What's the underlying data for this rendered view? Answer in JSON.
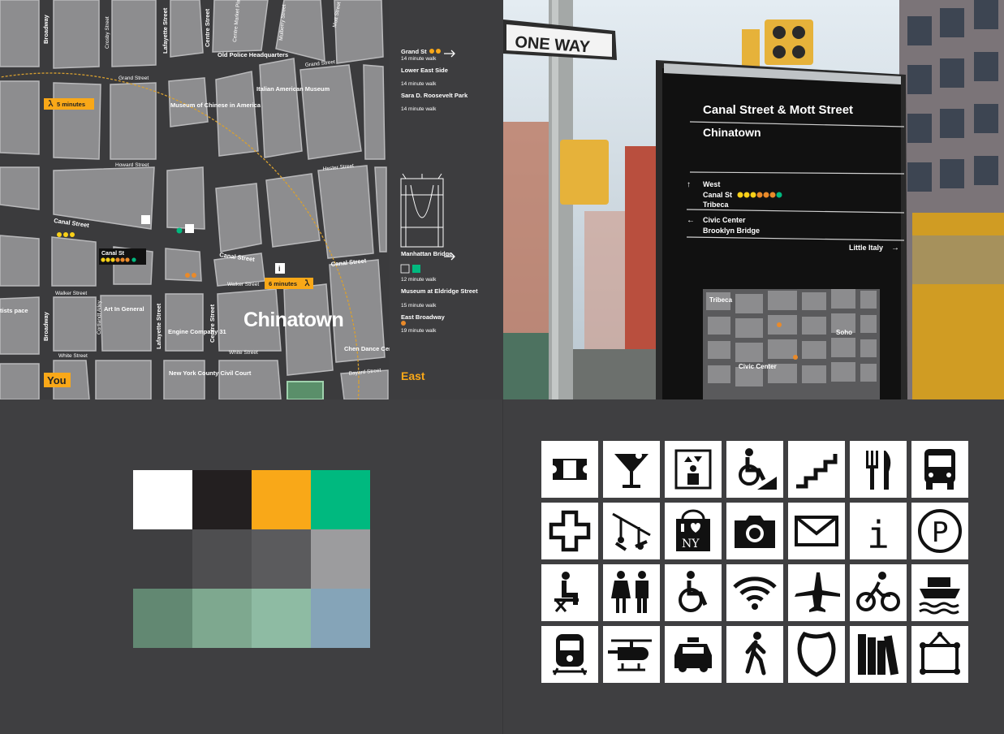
{
  "map": {
    "streets": {
      "broadway_top": "Broadway",
      "crosby": "Crosby Street",
      "lafayette_top": "Lafayette Street",
      "centre_top": "Centre Street",
      "centre_market": "Centre Market Place",
      "mulberry": "Mulberry Street",
      "mott": "Mott Street",
      "grand_left": "Grand Street",
      "grand_right": "Grand Street",
      "howard": "Howard Street",
      "hester": "Hester Street",
      "canal_left": "Canal Street",
      "canal_mid": "Canal Street",
      "canal_right": "Canal Street",
      "walker_left": "Walker Street",
      "walker_right": "Walker Street",
      "white_left": "White Street",
      "white_mid": "White Street",
      "broadway_bottom": "Broadway",
      "cortlandt": "Cortlandt Alley",
      "lafayette_bottom": "Lafayette Street",
      "centre_bottom": "Centre Street",
      "bayard": "Bayard Street"
    },
    "pois": {
      "old_police": "Old Police Headquarters",
      "italian_museum": "Italian American Museum",
      "museum_chinese": "Museum of Chinese in America",
      "art_in_general": "Art In General",
      "engine_company": "Engine Company 31",
      "ny_county": "New York County Civil Court",
      "chen_dance": "Chen Dance Center",
      "artists_space": "tists pace"
    },
    "neighborhood": "Chinatown",
    "walk_5": "5 minutes",
    "walk_6": "6 minutes",
    "you_label": "You",
    "station_label": "Canal St",
    "direction_label": "East",
    "destinations_top": [
      {
        "title": "Grand St",
        "sub": "14 minute walk"
      },
      {
        "title": "Lower East Side",
        "sub": "14 minute walk"
      },
      {
        "title": "Sara D. Roosevelt Park",
        "sub": "14 minute walk"
      }
    ],
    "destinations_bottom": [
      {
        "title": "Manhattan Bridge",
        "sub": "12 minute walk"
      },
      {
        "title": "Museum at Eldridge Street",
        "sub": "15 minute walk"
      },
      {
        "title": "East Broadway",
        "sub": "19 minute walk"
      }
    ]
  },
  "photo": {
    "one_way_sign": "ONE WAY",
    "kiosk_title": "Canal Street & Mott Street",
    "kiosk_subtitle": "Chinatown",
    "dir_west": "West",
    "dir_canal": "Canal St",
    "dir_tribeca": "Tribeca",
    "dir_civic": "Civic Center",
    "dir_bridge": "Brooklyn Bridge",
    "dir_little_italy": "Little Italy",
    "mini_tribeca": "Tribeca",
    "mini_soho": "Soho",
    "mini_civic": "Civic Center"
  },
  "palette": {
    "row1": [
      "#ffffff",
      "#231f20",
      "#f9a818",
      "#00b97f"
    ],
    "row2": [
      "#4e4e50",
      "#5b5b5d",
      "#9c9c9e"
    ],
    "row3": [
      "#628872",
      "#7ea88f",
      "#8ebba3",
      "#85a4b8"
    ]
  },
  "icons": {
    "rows": [
      [
        "ticket-icon",
        "cocktail-icon",
        "elevator-icon",
        "accessible-ramp-icon",
        "stairs-icon",
        "restaurant-icon",
        "bus-icon"
      ],
      [
        "hospital-icon",
        "playground-icon",
        "i-love-ny-shopping-icon",
        "camera-icon",
        "mail-icon",
        "information-icon",
        "parking-icon"
      ],
      [
        "seating-icon",
        "restroom-icon",
        "wheelchair-icon",
        "wifi-icon",
        "airport-icon",
        "bicycle-icon",
        "ferry-icon"
      ],
      [
        "train-icon",
        "heliport-icon",
        "taxi-icon",
        "pedestrian-icon",
        "police-icon",
        "library-icon",
        "art-museum-icon"
      ]
    ],
    "i_love_ny_text": "NY",
    "info_letter": "i",
    "parking_letter": "P"
  }
}
